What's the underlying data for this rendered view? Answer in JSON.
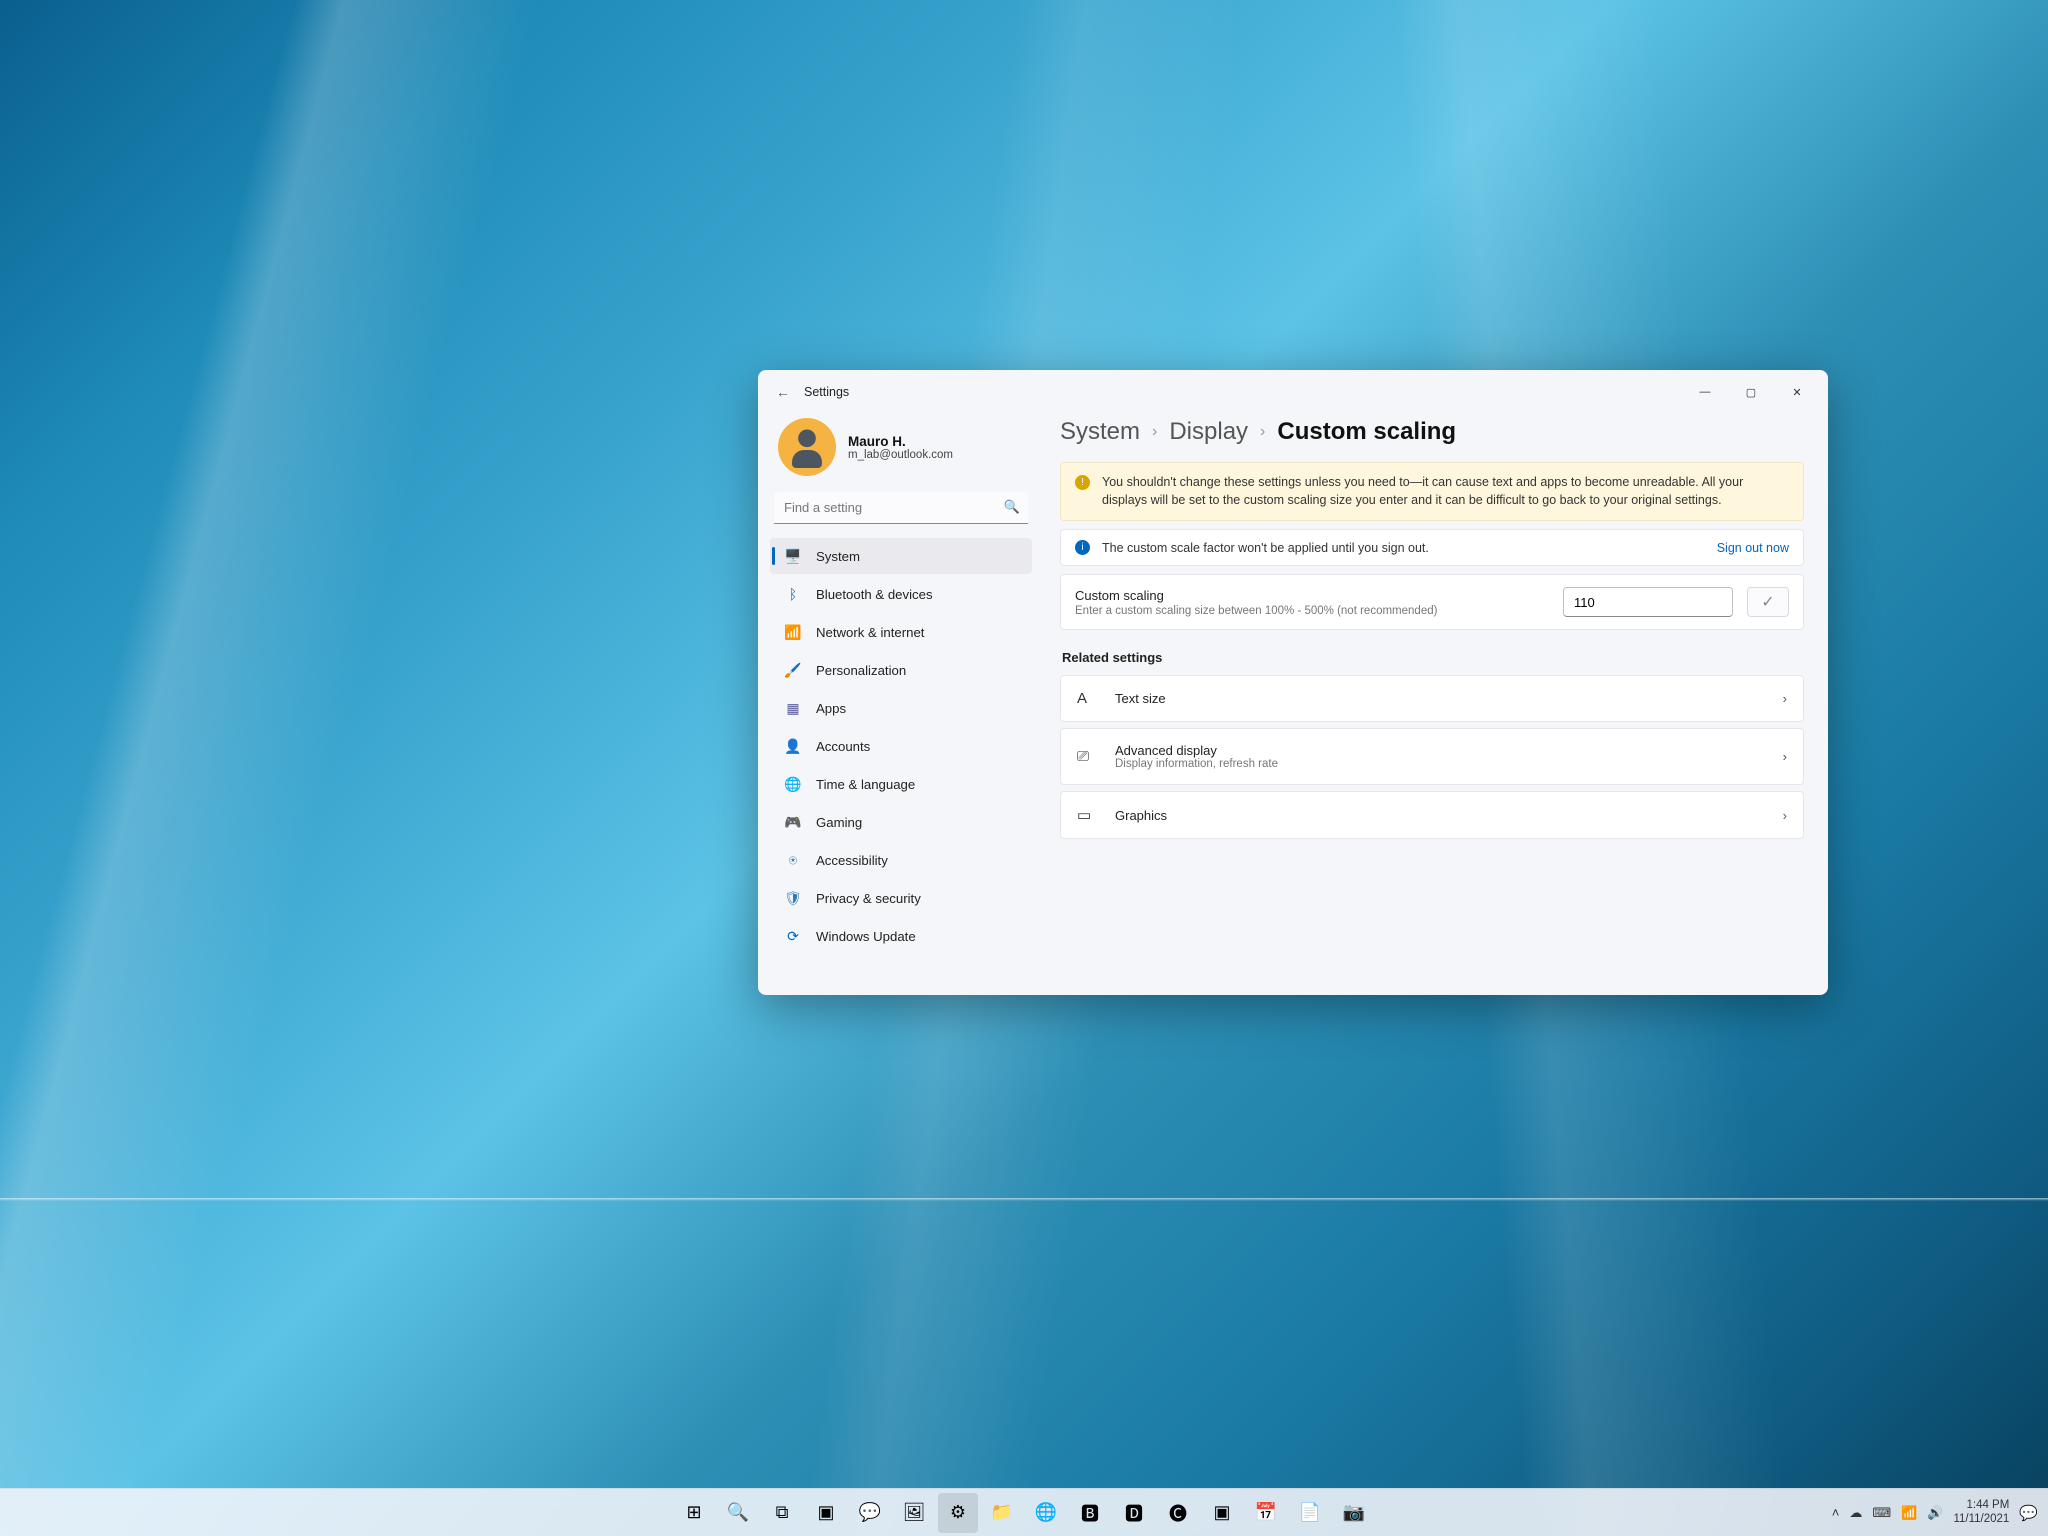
{
  "window": {
    "title": "Settings",
    "user": {
      "name": "Mauro H.",
      "email": "m_lab@outlook.com"
    },
    "search_placeholder": "Find a setting"
  },
  "sidebar": {
    "items": [
      {
        "label": "System",
        "icon": "🖥️",
        "active": true
      },
      {
        "label": "Bluetooth & devices",
        "icon": "ᛒ"
      },
      {
        "label": "Network & internet",
        "icon": "📶"
      },
      {
        "label": "Personalization",
        "icon": "🖌️"
      },
      {
        "label": "Apps",
        "icon": "▦"
      },
      {
        "label": "Accounts",
        "icon": "👤"
      },
      {
        "label": "Time & language",
        "icon": "🌐"
      },
      {
        "label": "Gaming",
        "icon": "🎮"
      },
      {
        "label": "Accessibility",
        "icon": "⍟"
      },
      {
        "label": "Privacy & security",
        "icon": "🛡"
      },
      {
        "label": "Windows Update",
        "icon": "⟳"
      }
    ]
  },
  "breadcrumb": {
    "a": "System",
    "b": "Display",
    "c": "Custom scaling"
  },
  "alert": "You shouldn't change these settings unless you need to—it can cause text and apps to become unreadable. All your displays will be set to the custom scaling size you enter and it can be difficult to go back to your original settings.",
  "info": {
    "text": "The custom scale factor won't be applied until you sign out.",
    "action": "Sign out now"
  },
  "scaling": {
    "title": "Custom scaling",
    "desc": "Enter a custom scaling size between 100% - 500% (not recommended)",
    "value": "110"
  },
  "related": {
    "heading": "Related settings",
    "items": [
      {
        "title": "Text size",
        "icon": "A"
      },
      {
        "title": "Advanced display",
        "desc": "Display information, refresh rate",
        "icon": "⎚"
      },
      {
        "title": "Graphics",
        "icon": "▭"
      }
    ]
  },
  "taskbar": {
    "buttons": [
      "start",
      "search",
      "taskview",
      "widgets",
      "chat",
      "photos",
      "settings",
      "explorer",
      "edge",
      "edge-beta",
      "edge-dev",
      "edge-canary",
      "terminal",
      "calendar",
      "notepad",
      "camera"
    ],
    "time": "1:44 PM",
    "date": "11/11/2021"
  }
}
